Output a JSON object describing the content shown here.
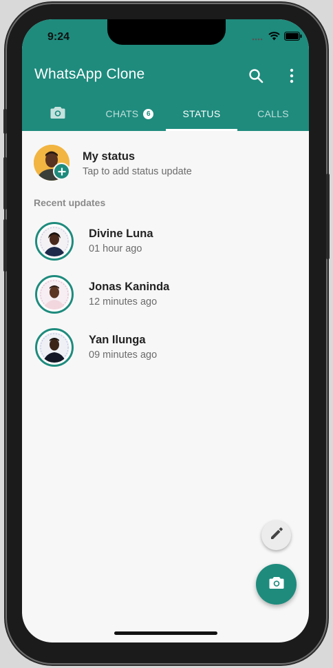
{
  "status_bar": {
    "time": "9:24",
    "icons": [
      "cellular-icon",
      "wifi-icon",
      "battery-icon"
    ]
  },
  "app_bar": {
    "title": "WhatsApp Clone",
    "icons": [
      "search-icon",
      "more-vert-icon"
    ]
  },
  "tabs": [
    {
      "label": "",
      "icon": "camera-icon"
    },
    {
      "label": "CHATS",
      "badge": "6"
    },
    {
      "label": "STATUS",
      "active": true
    },
    {
      "label": "CALLS"
    }
  ],
  "my_status": {
    "title": "My status",
    "subtitle": "Tap to add status update"
  },
  "recent_label": "Recent updates",
  "updates": [
    {
      "name": "Divine Luna",
      "time": "01 hour ago"
    },
    {
      "name": "Jonas Kaninda",
      "time": "12 minutes ago"
    },
    {
      "name": "Yan Ilunga",
      "time": "09 minutes ago"
    }
  ],
  "colors": {
    "primary": "#1e8b7d",
    "background": "#f7f7f7",
    "fab_small": "#ececec"
  },
  "fabs": {
    "small": "edit-icon",
    "large": "camera-icon"
  }
}
